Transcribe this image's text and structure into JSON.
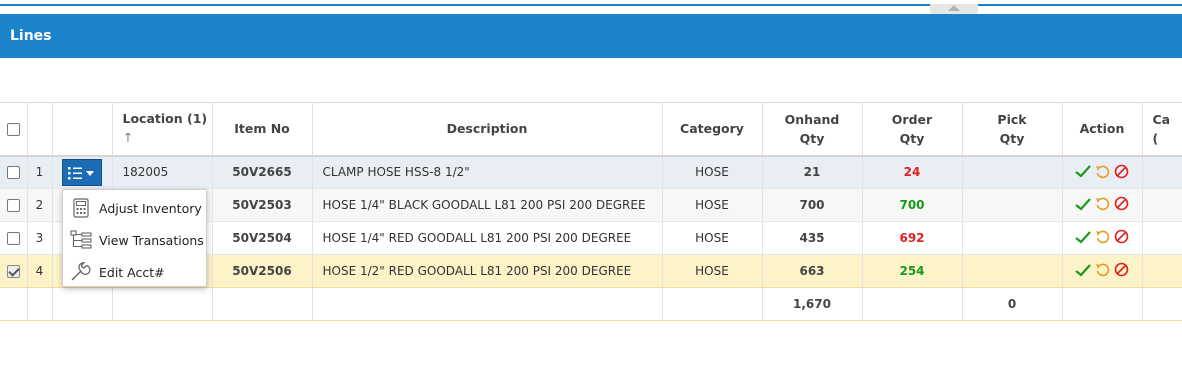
{
  "panel": {
    "title": "Lines"
  },
  "columns": {
    "location": "Location (1)",
    "sort_arrow": "↑",
    "item_no": "Item No",
    "description": "Description",
    "category": "Category",
    "onhand_line1": "Onhand",
    "onhand_line2": "Qty",
    "order_line1": "Order",
    "order_line2": "Qty",
    "pick_line1": "Pick",
    "pick_line2": "Qty",
    "action": "Action",
    "next_col_line1": "Ca",
    "next_col_line2": "("
  },
  "rows": [
    {
      "num": "1",
      "location": "182005",
      "item_no": "50V2665",
      "description": "CLAMP HOSE HSS-8 1/2\"",
      "category": "HOSE",
      "onhand": "21",
      "order": "24",
      "pick": ""
    },
    {
      "num": "2",
      "location": "",
      "item_no": "50V2503",
      "description": "HOSE 1/4\" BLACK GOODALL L81 200 PSI 200 DEGREE",
      "category": "HOSE",
      "onhand": "700",
      "order": "700",
      "pick": ""
    },
    {
      "num": "3",
      "location": "",
      "item_no": "50V2504",
      "description": "HOSE 1/4\" RED GOODALL L81 200 PSI 200 DEGREE",
      "category": "HOSE",
      "onhand": "435",
      "order": "692",
      "pick": ""
    },
    {
      "num": "4",
      "location": "",
      "item_no": "50V2506",
      "description": "HOSE 1/2\" RED GOODALL L81 200 PSI 200 DEGREE",
      "category": "HOSE",
      "onhand": "663",
      "order": "254",
      "pick": ""
    }
  ],
  "totals": {
    "onhand": "1,670",
    "pick": "0"
  },
  "context_menu": {
    "items": [
      {
        "label": "Adjust Inventory",
        "icon": "calculator-icon"
      },
      {
        "label": "View Transations",
        "icon": "tree-structure-icon"
      },
      {
        "label": "Edit Acct#",
        "icon": "wrench-icon"
      }
    ]
  },
  "colors": {
    "header_bar": "#1b82cc",
    "selected_row": "#fdf3c9",
    "menu_button": "#1b6cb3",
    "qty_red": "#e02020",
    "qty_green": "#1a9a1a",
    "action_check": "#1a9a1a",
    "action_undo": "#e0a020",
    "action_cancel": "#e02020"
  }
}
